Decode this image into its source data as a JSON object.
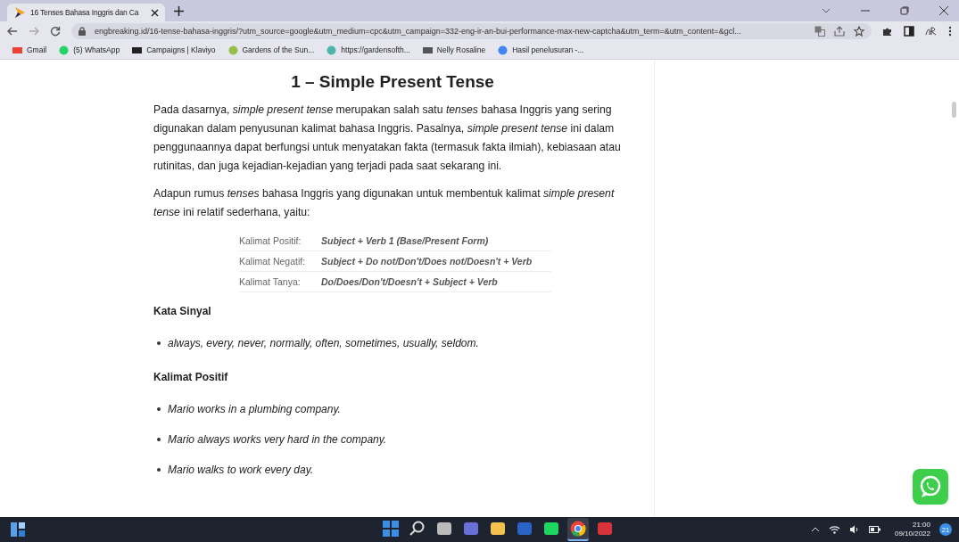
{
  "browser": {
    "tab": {
      "title": "16 Tenses Bahasa Inggris dan Ca",
      "selected": true
    },
    "url": "engbreaking.id/16-tense-bahasa-inggris/?utm_source=google&utm_medium=cpc&utm_campaign=332-eng-ir-an-bui-performance-max-new-captcha&utm_term=&utm_content=&gcl...",
    "bookmarks": [
      {
        "label": "Gmail",
        "kind": "gmail"
      },
      {
        "label": "(5) WhatsApp",
        "kind": "whatsapp"
      },
      {
        "label": "Campaigns | Klaviyo",
        "kind": "klaviyo"
      },
      {
        "label": "Gardens of the Sun...",
        "kind": "shop"
      },
      {
        "label": "https://gardensofth...",
        "kind": "globe"
      },
      {
        "label": "Nelly Rosaline",
        "kind": "nr"
      },
      {
        "label": "Hasil penelusuran -...",
        "kind": "google"
      }
    ]
  },
  "article": {
    "heading": "1 – Simple Present Tense",
    "paragraphs": [
      "Pada dasarnya, *simple present tense* merupakan salah satu *tenses* bahasa Inggris yang sering digunakan dalam penyusunan kalimat bahasa Inggris. Pasalnya, *simple present tense* ini dalam penggunaannya dapat berfungsi untuk menyatakan fakta (termasuk fakta ilmiah), kebiasaan atau rutinitas, dan juga kejadian-kejadian yang terjadi pada saat sekarang ini.",
      "Adapun rumus *tenses* bahasa Inggris yang digunakan untuk membentuk kalimat *simple present tense* ini relatif sederhana, yaitu:"
    ],
    "formulas": [
      {
        "label": "Kalimat Positif:",
        "formula": "Subject + Verb 1 (Base/Present Form)"
      },
      {
        "label": "Kalimat Negatif:",
        "formula": "Subject + Do not/Don't/Does not/Doesn't + Verb"
      },
      {
        "label": "Kalimat Tanya:",
        "formula": "Do/Does/Don't/Doesn't + Subject + Verb"
      }
    ],
    "sections": [
      {
        "title": "Kata Sinyal",
        "items": [
          "always, every, never, normally, often, sometimes, usually, seldom."
        ]
      },
      {
        "title": "Kalimat Positif",
        "items": [
          "Mario works in a plumbing company.",
          "Mario always works very hard in the company.",
          "Mario walks to work every day."
        ]
      }
    ]
  },
  "taskbar": {
    "apps": [
      {
        "kind": "start",
        "selected": false
      },
      {
        "kind": "search",
        "selected": false
      },
      {
        "kind": "taskview",
        "selected": false
      },
      {
        "kind": "chat",
        "selected": false
      },
      {
        "kind": "folder",
        "selected": false
      },
      {
        "kind": "word",
        "selected": false
      },
      {
        "kind": "spotify",
        "selected": false
      },
      {
        "kind": "chrome",
        "selected": true
      },
      {
        "kind": "red",
        "selected": false
      }
    ],
    "time": "21:00",
    "date": "09/10/2022",
    "badge": "21"
  }
}
